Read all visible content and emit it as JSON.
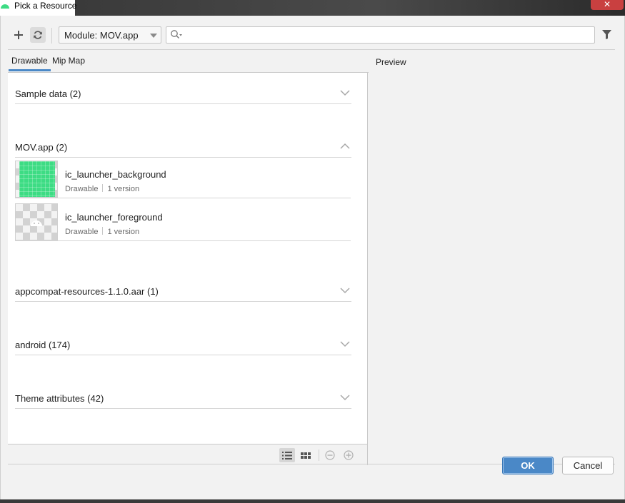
{
  "window": {
    "title": "Pick a Resource",
    "close_glyph": "✕",
    "app_icon": "android-studio-icon"
  },
  "toolbar": {
    "add_icon": "plus-icon",
    "refresh_icon": "refresh-icon",
    "module_label": "Module: MOV.app",
    "search_value": "",
    "search_placeholder": "",
    "filter_icon": "filter-icon"
  },
  "tabs": [
    {
      "label": "Drawable",
      "active": true
    },
    {
      "label": "Mip Map",
      "active": false
    }
  ],
  "sections": [
    {
      "name": "Sample data (2)",
      "expanded": false
    },
    {
      "name": "MOV.app (2)",
      "expanded": true
    },
    {
      "name": "appcompat-resources-1.1.0.aar (1)",
      "expanded": false
    },
    {
      "name": "android (174)",
      "expanded": false
    },
    {
      "name": "Theme attributes (42)",
      "expanded": false
    }
  ],
  "resources": [
    {
      "name": "ic_launcher_background",
      "type": "Drawable",
      "versions": "1 version"
    },
    {
      "name": "ic_launcher_foreground",
      "type": "Drawable",
      "versions": "1 version"
    }
  ],
  "view_controls": {
    "list_view_icon": "list-view-icon",
    "grid_view_icon": "grid-view-icon",
    "zoom_out_icon": "zoom-out-icon",
    "zoom_in_icon": "zoom-in-icon"
  },
  "preview": {
    "label": "Preview"
  },
  "buttons": {
    "ok": "OK",
    "cancel": "Cancel"
  },
  "colors": {
    "accent": "#4a88c7",
    "android_green": "#3ddc84"
  }
}
